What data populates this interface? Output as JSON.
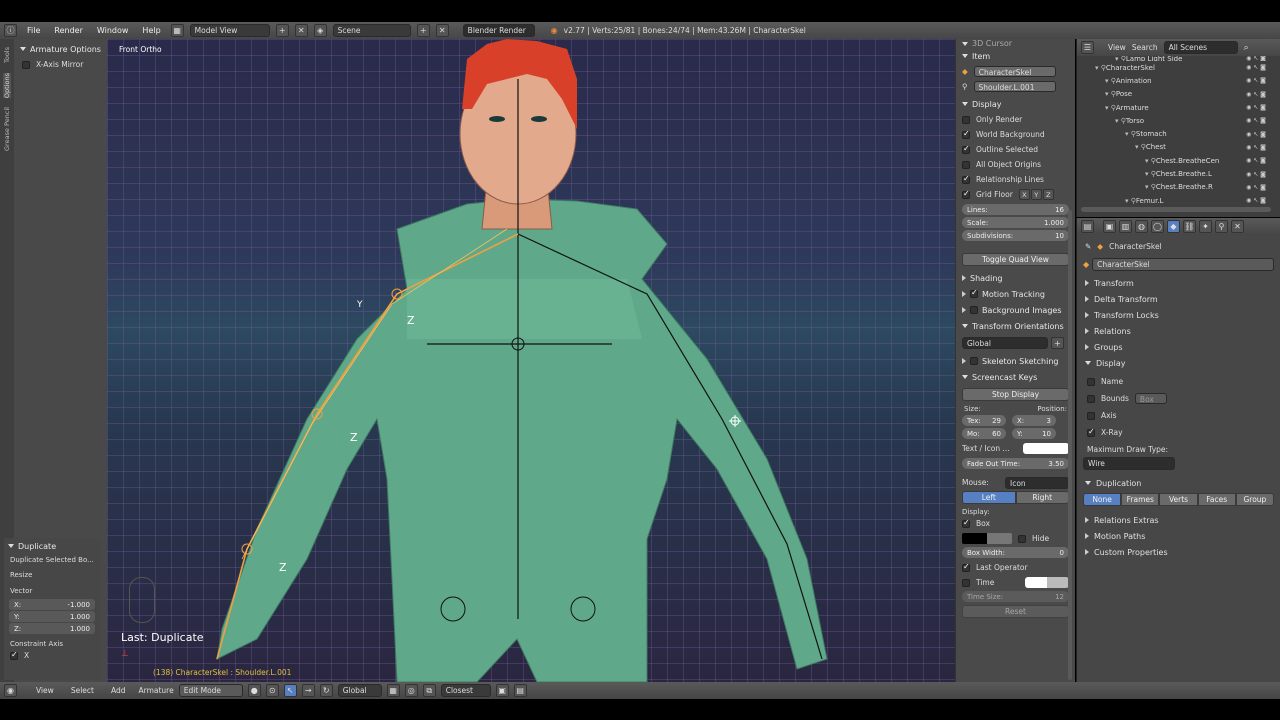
{
  "topbar": {
    "menus": [
      "File",
      "Render",
      "Window",
      "Help"
    ],
    "layout": "Model View",
    "scene": "Scene",
    "engine": "Blender Render",
    "stats": "v2.77 | Verts:25/81 | Bones:24/74 | Mem:43.26M | CharacterSkel"
  },
  "left_tool": {
    "vtabs": [
      "Tools",
      "Options",
      "Grease Pencil"
    ],
    "armature_options": "Armature Options",
    "x_axis_mirror": "X-Axis Mirror",
    "operator": {
      "title": "Duplicate",
      "subtitle": "Duplicate Selected Bo...",
      "resize": "Resize",
      "vector": "Vector",
      "x_label": "X:",
      "x_value": "-1.000",
      "y_label": "Y:",
      "y_value": "1.000",
      "z_label": "Z:",
      "z_value": "1.000",
      "constraint_axis": "Constraint Axis",
      "cx": "X"
    }
  },
  "viewport": {
    "view_name": "Front Ortho",
    "last_op": "Last: Duplicate",
    "status": "(138) CharacterSkel : Shoulder.L.001"
  },
  "props_panel": {
    "top_cut": "3D Cursor",
    "item": {
      "title": "Item",
      "object": "CharacterSkel",
      "bone": "Shoulder.L.001"
    },
    "display": {
      "title": "Display",
      "only_render": "Only Render",
      "world_background": "World Background",
      "outline_selected": "Outline Selected",
      "all_object_origins": "All Object Origins",
      "relationship_lines": "Relationship Lines",
      "grid_floor": "Grid Floor",
      "axis_x": "X",
      "axis_y": "Y",
      "axis_z": "Z",
      "lines_label": "Lines:",
      "lines_value": "16",
      "scale_label": "Scale:",
      "scale_value": "1.000",
      "subdiv_label": "Subdivisions:",
      "subdiv_value": "10",
      "toggle_quad": "Toggle Quad View"
    },
    "shading": "Shading",
    "motion_tracking": "Motion Tracking",
    "background_images": "Background Images",
    "transform_orientations": "Transform Orientations",
    "orientation_value": "Global",
    "skeleton_sketching": "Skeleton Sketching",
    "screencast": {
      "title": "Screencast Keys",
      "stop_display": "Stop Display",
      "size_label": "Size:",
      "position_label": "Position:",
      "tex_label": "Tex:",
      "tex_value": "29",
      "mo_label": "Mo:",
      "mo_value": "60",
      "x_label": "X:",
      "x_value": "3",
      "y_label": "Y:",
      "y_value": "10",
      "text_icon": "Text / Icon ...",
      "fade_label": "Fade Out Time:",
      "fade_value": "3.50",
      "mouse_label": "Mouse:",
      "mouse_value": "Icon",
      "left": "Left",
      "right": "Right",
      "display_label": "Display:",
      "box": "Box",
      "hide": "Hide",
      "box_width_label": "Box Width:",
      "box_width_value": "0",
      "last_operator": "Last Operator",
      "time": "Time",
      "time_size_label": "Time Size:",
      "time_size_value": "12",
      "reset": "Reset"
    }
  },
  "outliner": {
    "menus": [
      "View",
      "Search"
    ],
    "filter": "All Scenes",
    "rows": [
      {
        "label": "Lamp Light Side",
        "indent": 3
      },
      {
        "label": "CharacterSkel",
        "indent": 1
      },
      {
        "label": "Animation",
        "indent": 2
      },
      {
        "label": "Pose",
        "indent": 2
      },
      {
        "label": "Armature",
        "indent": 2
      },
      {
        "label": "Torso",
        "indent": 3
      },
      {
        "label": "Stomach",
        "indent": 4
      },
      {
        "label": "Chest",
        "indent": 5
      },
      {
        "label": "Chest.BreatheCen",
        "indent": 6
      },
      {
        "label": "Chest.Breathe.L",
        "indent": 6
      },
      {
        "label": "Chest.Breathe.R",
        "indent": 6
      },
      {
        "label": "Femur.L",
        "indent": 4
      }
    ]
  },
  "properties": {
    "breadcrumb": "CharacterSkel",
    "name_field": "CharacterSkel",
    "sections_top": [
      "Transform",
      "Delta Transform",
      "Transform Locks",
      "Relations",
      "Groups"
    ],
    "display_title": "Display",
    "name": "Name",
    "bounds": "Bounds",
    "bounds_type": "Box",
    "axis": "Axis",
    "xray": "X-Ray",
    "max_draw_label": "Maximum Draw Type:",
    "max_draw_value": "Wire",
    "duplication_title": "Duplication",
    "dup_options": [
      "None",
      "Frames",
      "Verts",
      "Faces",
      "Group"
    ],
    "sections_bottom": [
      "Relations Extras",
      "Motion Paths",
      "Custom Properties"
    ]
  },
  "bottombar": {
    "menus": [
      "View",
      "Select",
      "Add",
      "Armature"
    ],
    "mode": "Edit Mode",
    "orientation": "Global",
    "snap": "Closest"
  }
}
